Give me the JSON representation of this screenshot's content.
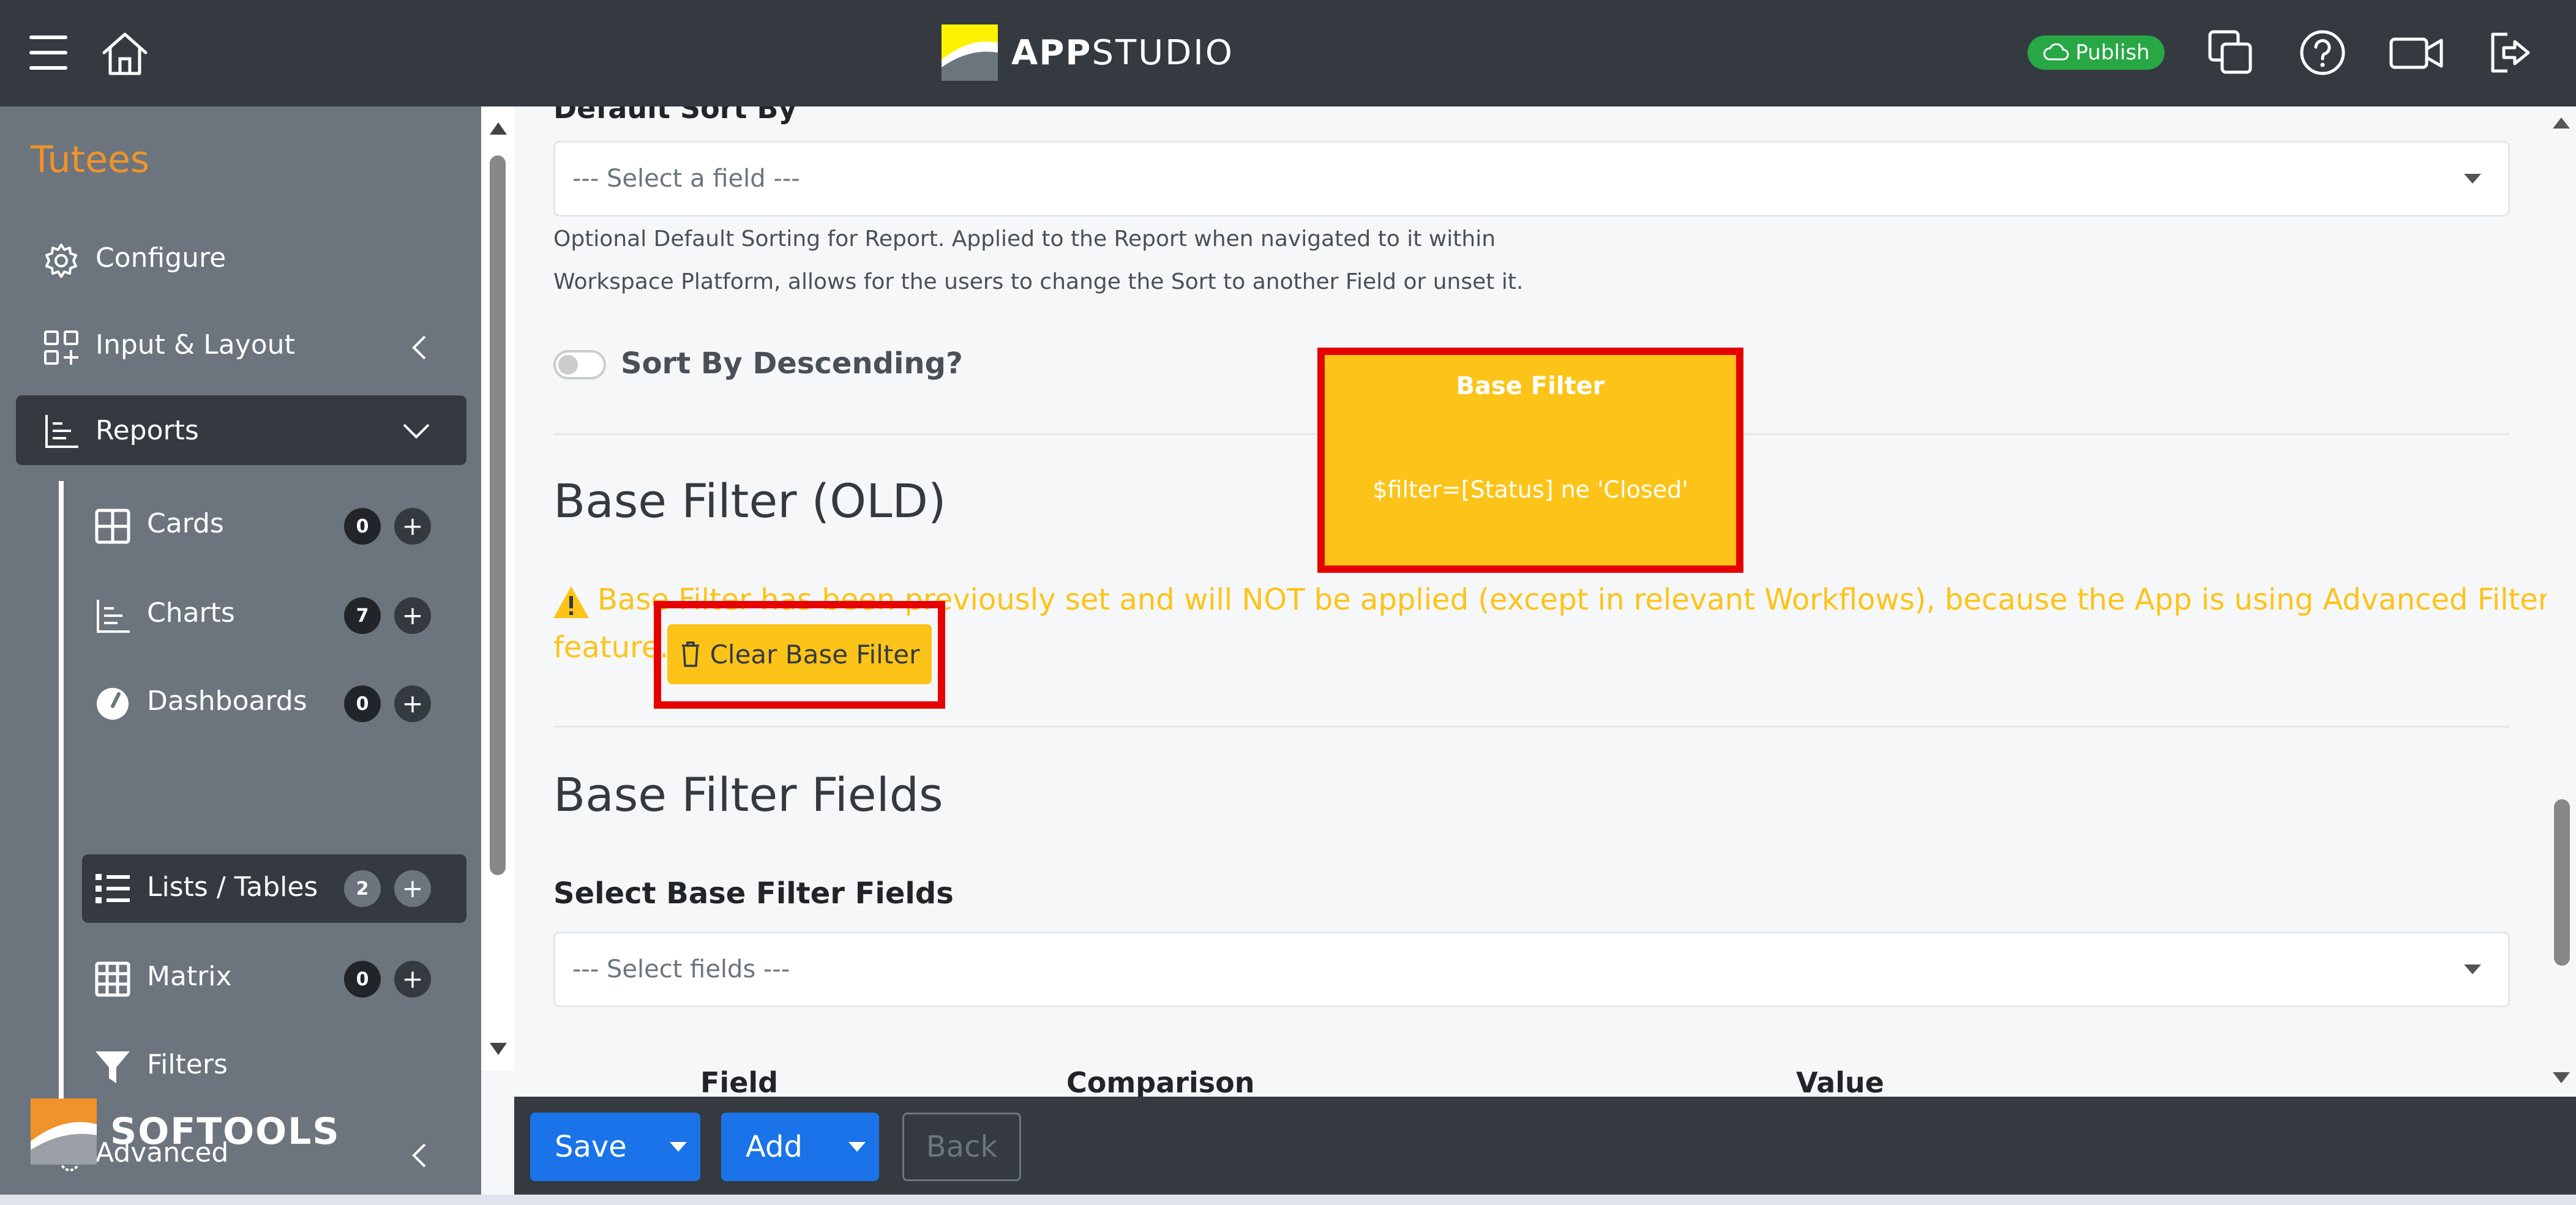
{
  "app": {
    "brand_prefix": "APP",
    "brand_suffix": "STUDIO",
    "publish_label": "Publish",
    "footer_brand": "SOFTOOLS"
  },
  "sidebar": {
    "app_name": "Tutees",
    "items": [
      {
        "label": "Configure"
      },
      {
        "label": "Input & Layout"
      },
      {
        "label": "Reports"
      },
      {
        "label": "Cards",
        "count": "0"
      },
      {
        "label": "Charts",
        "count": "7"
      },
      {
        "label": "Dashboards",
        "count": "0"
      },
      {
        "label": "Lists / Tables",
        "count": "2"
      },
      {
        "label": "Matrix",
        "count": "0"
      },
      {
        "label": "Filters"
      },
      {
        "label": "Advanced"
      }
    ]
  },
  "main": {
    "default_sort_label": "Default Sort By",
    "sort_select_placeholder": "--- Select a field ---",
    "sort_help_line1": "Optional Default Sorting for Report. Applied to the Report when navigated to it within",
    "sort_help_line2": "Workspace Platform, allows for the users to change the Sort to another Field or unset it.",
    "sort_desc_label": "Sort By Descending?",
    "base_filter_heading": "Base Filter (OLD)",
    "warning_line1": "Base Filter has been previously set and will NOT be applied (except in relevant Workflows), because the App is using Advanced Filters",
    "warning_line2": "feature.",
    "clear_button_label": "Clear Base Filter",
    "base_filter_fields_heading": "Base Filter Fields",
    "select_fields_label": "Select Base Filter Fields",
    "fields_select_placeholder": "--- Select fields ---",
    "table_headers": [
      "Field",
      "Comparison",
      "Value"
    ]
  },
  "tooltip": {
    "title": "Base Filter",
    "body": "$filter=[Status] ne 'Closed'"
  },
  "footer": {
    "save_label": "Save",
    "add_label": "Add",
    "back_label": "Back"
  },
  "colors": {
    "topbar": "#343a40",
    "sidebar": "#6c757d",
    "accent_orange": "#f0932b",
    "warning_yellow": "#fcc419",
    "primary_blue": "#1a73e8",
    "publish_green": "#28a745",
    "highlight_red": "#e60000"
  }
}
